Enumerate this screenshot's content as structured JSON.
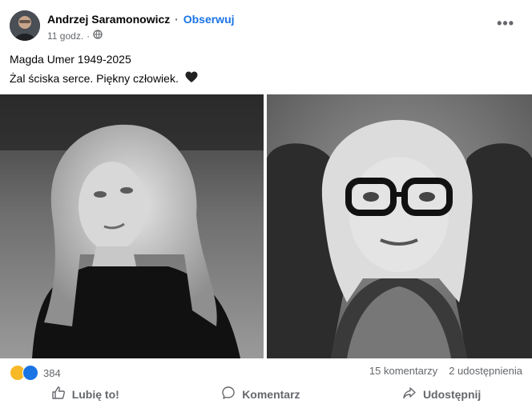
{
  "post": {
    "author": "Andrzej Saramonowicz",
    "separator": "·",
    "follow_label": "Obserwuj",
    "time": "11 godz.",
    "meta_separator": "·",
    "more_icon": "more-dots-icon",
    "privacy_icon": "globe-icon",
    "text_line1": "Magda Umer 1949-2025",
    "text_line2": "Żal ściska serce. Piękny człowiek.",
    "emoji": "black-heart-icon"
  },
  "stats": {
    "reaction_icons": [
      "haha-reaction-icon",
      "like-reaction-icon"
    ],
    "reaction_count": "384",
    "comments": "15 komentarzy",
    "shares": "2 udostępnienia"
  },
  "actions": {
    "like_label": "Lubię to!",
    "comment_label": "Komentarz",
    "share_label": "Udostępnij"
  },
  "colors": {
    "link": "#1b74e4",
    "secondary_text": "#65676b",
    "text": "#050505"
  }
}
